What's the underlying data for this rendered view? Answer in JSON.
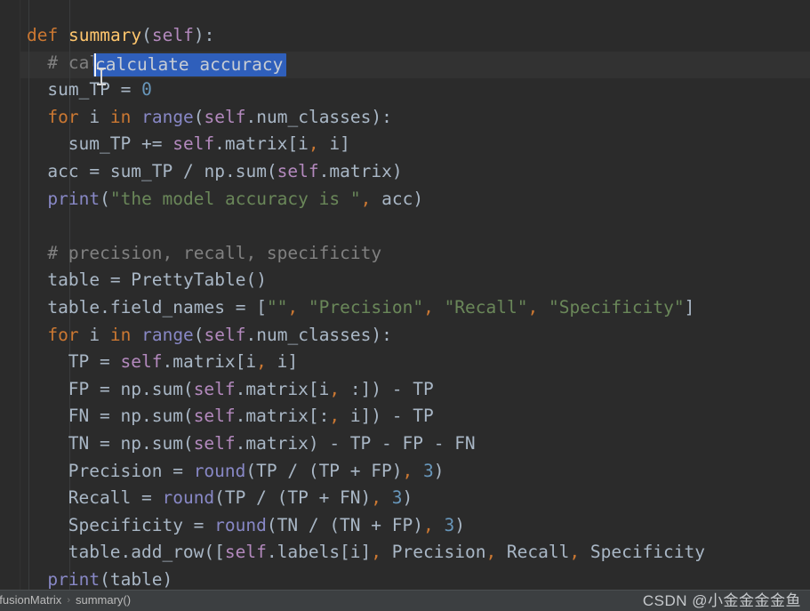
{
  "editor": {
    "language": "python",
    "current_line_index": 1,
    "selection": {
      "text": "calculate accuracy",
      "line_index": 1,
      "highlight_color": "#2f5fbb"
    },
    "theme": {
      "background": "#2b2b2b",
      "default_text": "#a9b7c6",
      "keyword": "#cc7832",
      "function_name": "#ffc66d",
      "self_keyword": "#b389bd",
      "builtin": "#8888c6",
      "number": "#6897bb",
      "string": "#6a8759",
      "comment": "#808080",
      "current_line": "#323232",
      "indent_guide": "#3a3c3d"
    },
    "lines": [
      {
        "indent": 1,
        "tokens": [
          {
            "t": "def",
            "c": "kw"
          },
          {
            "t": " ",
            "c": "def"
          },
          {
            "t": "summary",
            "c": "fn"
          },
          {
            "t": "(",
            "c": "def"
          },
          {
            "t": "self",
            "c": "self"
          },
          {
            "t": "):",
            "c": "def"
          }
        ]
      },
      {
        "indent": 2,
        "tokens": [
          {
            "t": "# calculate accuracy",
            "c": "cmt"
          }
        ]
      },
      {
        "indent": 2,
        "tokens": [
          {
            "t": "sum_TP = ",
            "c": "def"
          },
          {
            "t": "0",
            "c": "num"
          }
        ]
      },
      {
        "indent": 2,
        "tokens": [
          {
            "t": "for",
            "c": "kw"
          },
          {
            "t": " i ",
            "c": "def"
          },
          {
            "t": "in",
            "c": "kw"
          },
          {
            "t": " ",
            "c": "def"
          },
          {
            "t": "range",
            "c": "builtin"
          },
          {
            "t": "(",
            "c": "def"
          },
          {
            "t": "self",
            "c": "self"
          },
          {
            "t": ".num_classes):",
            "c": "def"
          }
        ]
      },
      {
        "indent": 3,
        "tokens": [
          {
            "t": "sum_TP += ",
            "c": "def"
          },
          {
            "t": "self",
            "c": "self"
          },
          {
            "t": ".matrix[i",
            "c": "def"
          },
          {
            "t": ",",
            "c": "comma"
          },
          {
            "t": " i]",
            "c": "def"
          }
        ]
      },
      {
        "indent": 2,
        "tokens": [
          {
            "t": "acc = sum_TP / np.sum(",
            "c": "def"
          },
          {
            "t": "self",
            "c": "self"
          },
          {
            "t": ".matrix)",
            "c": "def"
          }
        ]
      },
      {
        "indent": 2,
        "tokens": [
          {
            "t": "print",
            "c": "builtin"
          },
          {
            "t": "(",
            "c": "def"
          },
          {
            "t": "\"the model accuracy is \"",
            "c": "str"
          },
          {
            "t": ",",
            "c": "comma"
          },
          {
            "t": " acc)",
            "c": "def"
          }
        ]
      },
      {
        "indent": 0,
        "tokens": []
      },
      {
        "indent": 2,
        "tokens": [
          {
            "t": "# precision, recall, specificity",
            "c": "cmt"
          }
        ]
      },
      {
        "indent": 2,
        "tokens": [
          {
            "t": "table = PrettyTable()",
            "c": "def"
          }
        ]
      },
      {
        "indent": 2,
        "tokens": [
          {
            "t": "table.field_names = [",
            "c": "def"
          },
          {
            "t": "\"\"",
            "c": "str"
          },
          {
            "t": ",",
            "c": "comma"
          },
          {
            "t": " ",
            "c": "def"
          },
          {
            "t": "\"Precision\"",
            "c": "str"
          },
          {
            "t": ",",
            "c": "comma"
          },
          {
            "t": " ",
            "c": "def"
          },
          {
            "t": "\"Recall\"",
            "c": "str"
          },
          {
            "t": ",",
            "c": "comma"
          },
          {
            "t": " ",
            "c": "def"
          },
          {
            "t": "\"Specificity\"",
            "c": "str"
          },
          {
            "t": "]",
            "c": "def"
          }
        ]
      },
      {
        "indent": 2,
        "tokens": [
          {
            "t": "for",
            "c": "kw"
          },
          {
            "t": " i ",
            "c": "def"
          },
          {
            "t": "in",
            "c": "kw"
          },
          {
            "t": " ",
            "c": "def"
          },
          {
            "t": "range",
            "c": "builtin"
          },
          {
            "t": "(",
            "c": "def"
          },
          {
            "t": "self",
            "c": "self"
          },
          {
            "t": ".num_classes):",
            "c": "def"
          }
        ]
      },
      {
        "indent": 3,
        "tokens": [
          {
            "t": "TP = ",
            "c": "def"
          },
          {
            "t": "self",
            "c": "self"
          },
          {
            "t": ".matrix[i",
            "c": "def"
          },
          {
            "t": ",",
            "c": "comma"
          },
          {
            "t": " i]",
            "c": "def"
          }
        ]
      },
      {
        "indent": 3,
        "tokens": [
          {
            "t": "FP = np.sum(",
            "c": "def"
          },
          {
            "t": "self",
            "c": "self"
          },
          {
            "t": ".matrix[i",
            "c": "def"
          },
          {
            "t": ",",
            "c": "comma"
          },
          {
            "t": " :]) - TP",
            "c": "def"
          }
        ]
      },
      {
        "indent": 3,
        "tokens": [
          {
            "t": "FN = np.sum(",
            "c": "def"
          },
          {
            "t": "self",
            "c": "self"
          },
          {
            "t": ".matrix[:",
            "c": "def"
          },
          {
            "t": ",",
            "c": "comma"
          },
          {
            "t": " i]) - TP",
            "c": "def"
          }
        ]
      },
      {
        "indent": 3,
        "tokens": [
          {
            "t": "TN = np.sum(",
            "c": "def"
          },
          {
            "t": "self",
            "c": "self"
          },
          {
            "t": ".matrix) - TP - FP - FN",
            "c": "def"
          }
        ]
      },
      {
        "indent": 3,
        "tokens": [
          {
            "t": "Precision = ",
            "c": "def"
          },
          {
            "t": "round",
            "c": "builtin"
          },
          {
            "t": "(TP / (TP + FP)",
            "c": "def"
          },
          {
            "t": ",",
            "c": "comma"
          },
          {
            "t": " ",
            "c": "def"
          },
          {
            "t": "3",
            "c": "num"
          },
          {
            "t": ")",
            "c": "def"
          }
        ]
      },
      {
        "indent": 3,
        "tokens": [
          {
            "t": "Recall = ",
            "c": "def"
          },
          {
            "t": "round",
            "c": "builtin"
          },
          {
            "t": "(TP / (TP + FN)",
            "c": "def"
          },
          {
            "t": ",",
            "c": "comma"
          },
          {
            "t": " ",
            "c": "def"
          },
          {
            "t": "3",
            "c": "num"
          },
          {
            "t": ")",
            "c": "def"
          }
        ]
      },
      {
        "indent": 3,
        "tokens": [
          {
            "t": "Specificity = ",
            "c": "def"
          },
          {
            "t": "round",
            "c": "builtin"
          },
          {
            "t": "(TN / (TN + FP)",
            "c": "def"
          },
          {
            "t": ",",
            "c": "comma"
          },
          {
            "t": " ",
            "c": "def"
          },
          {
            "t": "3",
            "c": "num"
          },
          {
            "t": ")",
            "c": "def"
          }
        ]
      },
      {
        "indent": 3,
        "tokens": [
          {
            "t": "table.add_row([",
            "c": "def"
          },
          {
            "t": "self",
            "c": "self"
          },
          {
            "t": ".labels[i]",
            "c": "def"
          },
          {
            "t": ",",
            "c": "comma"
          },
          {
            "t": " Precision",
            "c": "def"
          },
          {
            "t": ",",
            "c": "comma"
          },
          {
            "t": " Recall",
            "c": "def"
          },
          {
            "t": ",",
            "c": "comma"
          },
          {
            "t": " Specificity",
            "c": "def"
          }
        ]
      },
      {
        "indent": 2,
        "tokens": [
          {
            "t": "print",
            "c": "builtin"
          },
          {
            "t": "(table)",
            "c": "def"
          }
        ]
      }
    ]
  },
  "breadcrumb": {
    "items": [
      "nfusionMatrix",
      "summary()"
    ],
    "separator": "›"
  },
  "watermark": {
    "text": "CSDN @小金金金金鱼"
  }
}
